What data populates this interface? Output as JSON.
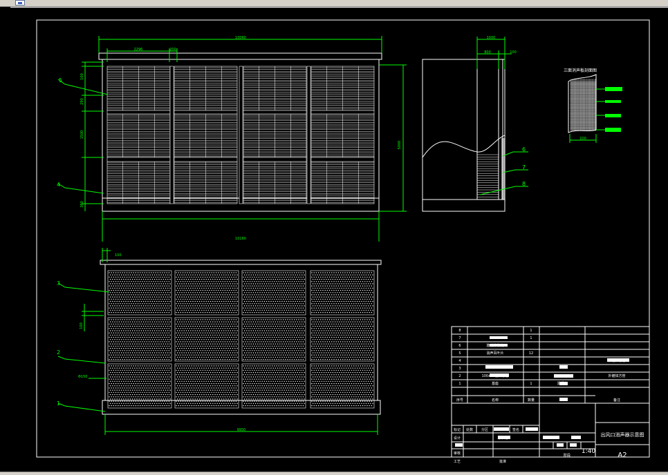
{
  "window": {
    "tab_icon": "drawing-file-icon"
  },
  "dimensions": {
    "front_overall_top": "10060",
    "front_module": "2296",
    "front_gap": "200",
    "front_height": "5000",
    "front_bottom": "10160",
    "front_left_top": "100",
    "front_left_mid1": "290",
    "front_left_mid2": "1500",
    "front_left_base": "380",
    "side_top": "1000",
    "side_mid": "800",
    "side_right": "100",
    "detail_width": "100",
    "plan_top": "100",
    "plan_left": "100",
    "plan_hole": "Φ150",
    "plan_bottom": "9950"
  },
  "detail_title": "三面消声板剖面图",
  "callouts": {
    "c1": "1",
    "c2": "2",
    "c3": "3",
    "c4": "4",
    "c5": "5",
    "c6": "6",
    "c7": "7",
    "c8": "8"
  },
  "title_block": {
    "rows": [
      {
        "no": "8",
        "name": "",
        "qty": "1",
        "material": "",
        "note": ""
      },
      {
        "no": "7",
        "name": "",
        "qty": "1",
        "material": "",
        "note": ""
      },
      {
        "no": "6",
        "name": "玻璃棉填充",
        "qty": "",
        "material": "",
        "note": ""
      },
      {
        "no": "5",
        "name": "消声百叶片",
        "qty": "12",
        "material": "",
        "note": ""
      },
      {
        "no": "4",
        "name": "",
        "qty": "",
        "material": "",
        "note": "外镀锌方管"
      },
      {
        "no": "3",
        "name": "",
        "qty": "",
        "material": "",
        "note": ""
      },
      {
        "no": "2",
        "name": "100x50镀锌方管",
        "qty": "",
        "material": "",
        "note": "外镀锌方管"
      },
      {
        "no": "1",
        "name": "基座",
        "qty": "1",
        "material": "混凝土",
        "note": ""
      }
    ],
    "headers": {
      "no": "序号",
      "name": "名称",
      "qty": "数量",
      "note": "备注"
    },
    "sign": {
      "mark": "标记",
      "count": "处数",
      "zone": "分区",
      "sign": "签名",
      "design": "设计",
      "standard": "标准化",
      "review": "审核",
      "craft": "工艺",
      "approve": "批准",
      "stage": "阶段"
    },
    "drawing_name": "出风口消声器示意图",
    "scale": "1:40",
    "sheet": "A2"
  },
  "colors": {
    "green": "#00ff00",
    "white": "#ffffff",
    "background": "#000000"
  }
}
